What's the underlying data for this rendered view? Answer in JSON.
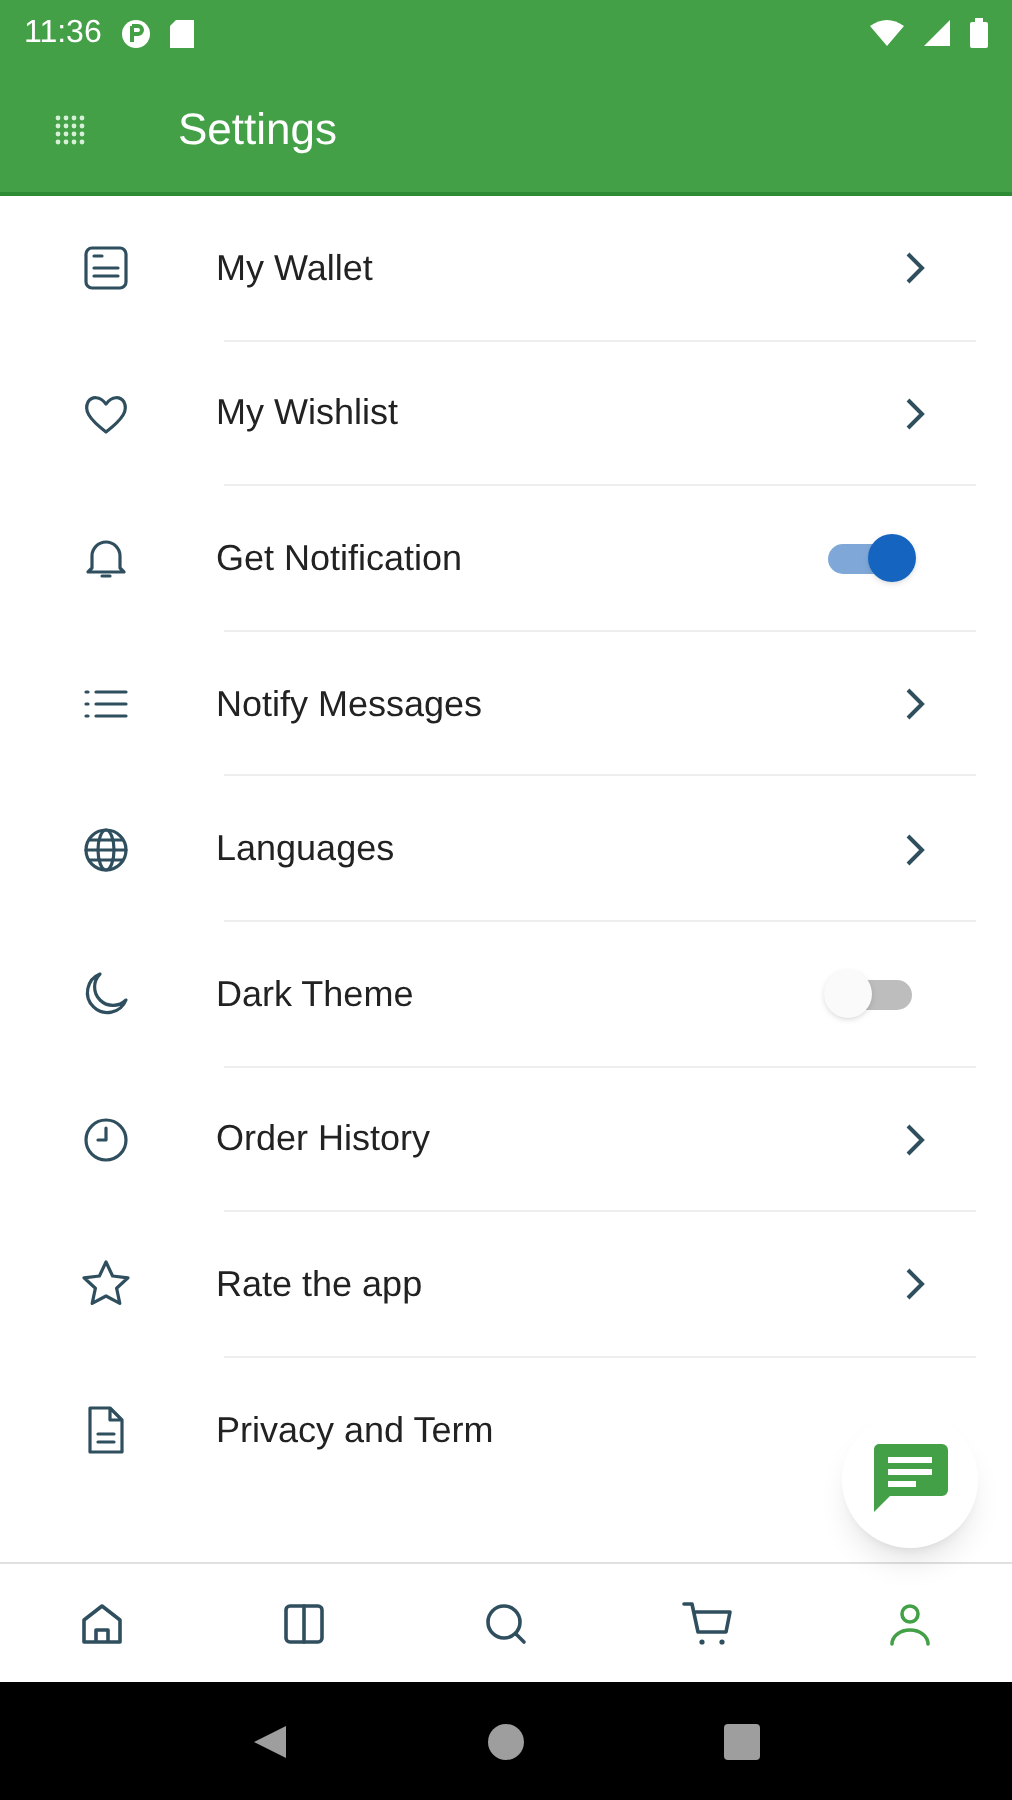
{
  "status_bar": {
    "time": "11:36"
  },
  "app_bar": {
    "title": "Settings"
  },
  "items": [
    {
      "label": "My Wallet",
      "kind": "link"
    },
    {
      "label": "My Wishlist",
      "kind": "link"
    },
    {
      "label": "Get Notification",
      "kind": "toggle",
      "on": true
    },
    {
      "label": "Notify Messages",
      "kind": "link"
    },
    {
      "label": "Languages",
      "kind": "link"
    },
    {
      "label": "Dark Theme",
      "kind": "toggle",
      "on": false
    },
    {
      "label": "Order History",
      "kind": "link"
    },
    {
      "label": "Rate the app",
      "kind": "link"
    },
    {
      "label": "Privacy and Term",
      "kind": "plain"
    }
  ],
  "bottom_nav": [
    {
      "selected": false
    },
    {
      "selected": false
    },
    {
      "selected": false
    },
    {
      "selected": false
    },
    {
      "selected": true
    }
  ]
}
